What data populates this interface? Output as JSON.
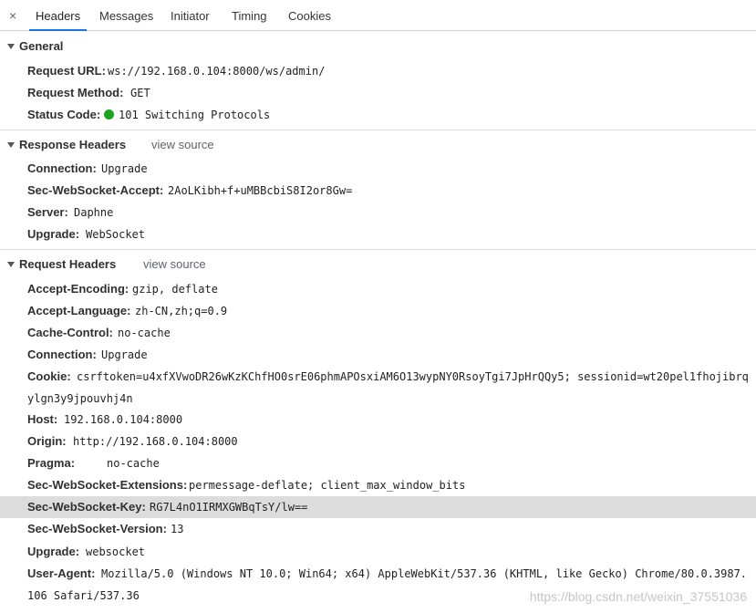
{
  "tabs": {
    "close_icon": "×",
    "items": [
      "Headers",
      "Messages",
      "Initiator",
      "Timing",
      "Cookies"
    ],
    "active": "Headers"
  },
  "general": {
    "title": "General",
    "rows": [
      {
        "key": "Request URL:",
        "value": "ws://192.168.0.104:8000/ws/admin/"
      },
      {
        "key": "Request Method:",
        "value": "GET"
      },
      {
        "key": "Status Code:",
        "value": "101 Switching Protocols",
        "status_color": "#1ca21c"
      }
    ]
  },
  "response_headers": {
    "title": "Response Headers",
    "view_source": "view source",
    "rows": [
      {
        "key": "Connection:",
        "value": "Upgrade"
      },
      {
        "key": "Sec-WebSocket-Accept:",
        "value": "2AoLKibh+f+uMBBcbiS8I2or8Gw="
      },
      {
        "key": "Server:",
        "value": "Daphne"
      },
      {
        "key": "Upgrade:",
        "value": "WebSocket"
      }
    ]
  },
  "request_headers": {
    "title": "Request Headers",
    "view_source": "view source",
    "rows": [
      {
        "key": "Accept-Encoding:",
        "value": "gzip, deflate"
      },
      {
        "key": "Accept-Language:",
        "value": "zh-CN,zh;q=0.9"
      },
      {
        "key": "Cache-Control:",
        "value": "no-cache"
      },
      {
        "key": "Connection:",
        "value": "Upgrade"
      },
      {
        "key": "Cookie:",
        "value": "csrftoken=u4xfXVwoDR26wKzKChfHO0srE06phmAPOsxiAM6O13wypNY0RsoyTgi7JpHrQQy5; sessionid=wt20pel1fhojibrq",
        "value_cont": "ylgn3y9jpouvhj4n"
      },
      {
        "key": "Host:",
        "value": "192.168.0.104:8000"
      },
      {
        "key": "Origin:",
        "value": "http://192.168.0.104:8000"
      },
      {
        "key": "Pragma:",
        "value": "no-cache"
      },
      {
        "key": "Sec-WebSocket-Extensions:",
        "value": "permessage-deflate; client_max_window_bits"
      },
      {
        "key": "Sec-WebSocket-Key:",
        "value": "RG7L4nO1IRMXGWBqTsY/lw==",
        "highlighted": true
      },
      {
        "key": "Sec-WebSocket-Version:",
        "value": "13"
      },
      {
        "key": "Upgrade:",
        "value": "websocket"
      },
      {
        "key": "User-Agent:",
        "value": "Mozilla/5.0 (Windows NT 10.0; Win64; x64) AppleWebKit/537.36 (KHTML, like Gecko) Chrome/80.0.3987.",
        "value_cont": "106 Safari/537.36"
      }
    ]
  },
  "watermark": "https://blog.csdn.net/weixin_37551036"
}
